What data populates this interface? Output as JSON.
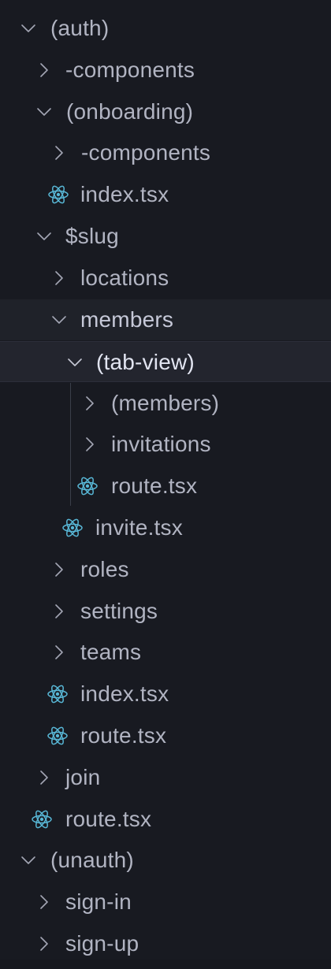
{
  "explorer": {
    "items": [
      {
        "label": "(auth)",
        "kind": "folder",
        "expanded": true,
        "icon": "chevron-down-icon"
      },
      {
        "label": "-components",
        "kind": "folder",
        "expanded": false,
        "icon": "chevron-right-icon"
      },
      {
        "label": "(onboarding)",
        "kind": "folder",
        "expanded": true,
        "icon": "chevron-down-icon"
      },
      {
        "label": "-components",
        "kind": "folder",
        "expanded": false,
        "icon": "chevron-right-icon"
      },
      {
        "label": "index.tsx",
        "kind": "file",
        "icon": "react-icon"
      },
      {
        "label": "$slug",
        "kind": "folder",
        "expanded": true,
        "icon": "chevron-down-icon"
      },
      {
        "label": "locations",
        "kind": "folder",
        "expanded": false,
        "icon": "chevron-right-icon"
      },
      {
        "label": "members",
        "kind": "folder",
        "expanded": true,
        "icon": "chevron-down-icon",
        "state": "hover"
      },
      {
        "label": "(tab-view)",
        "kind": "folder",
        "expanded": true,
        "icon": "chevron-down-icon",
        "state": "selected"
      },
      {
        "label": "(members)",
        "kind": "folder",
        "expanded": false,
        "icon": "chevron-right-icon"
      },
      {
        "label": "invitations",
        "kind": "folder",
        "expanded": false,
        "icon": "chevron-right-icon"
      },
      {
        "label": "route.tsx",
        "kind": "file",
        "icon": "react-icon"
      },
      {
        "label": "invite.tsx",
        "kind": "file",
        "icon": "react-icon"
      },
      {
        "label": "roles",
        "kind": "folder",
        "expanded": false,
        "icon": "chevron-right-icon"
      },
      {
        "label": "settings",
        "kind": "folder",
        "expanded": false,
        "icon": "chevron-right-icon"
      },
      {
        "label": "teams",
        "kind": "folder",
        "expanded": false,
        "icon": "chevron-right-icon"
      },
      {
        "label": "index.tsx",
        "kind": "file",
        "icon": "react-icon"
      },
      {
        "label": "route.tsx",
        "kind": "file",
        "icon": "react-icon"
      },
      {
        "label": "join",
        "kind": "folder",
        "expanded": false,
        "icon": "chevron-right-icon"
      },
      {
        "label": "route.tsx",
        "kind": "file",
        "icon": "react-icon"
      },
      {
        "label": "(unauth)",
        "kind": "folder",
        "expanded": true,
        "icon": "chevron-down-icon"
      },
      {
        "label": "sign-in",
        "kind": "folder",
        "expanded": false,
        "icon": "chevron-right-icon"
      },
      {
        "label": "sign-up",
        "kind": "folder",
        "expanded": false,
        "icon": "chevron-right-icon"
      }
    ]
  },
  "colors": {
    "background": "#181a21",
    "text": "#b1b4c2",
    "icon_chevron": "#a3a6b4",
    "icon_react": "#58b7d6"
  }
}
